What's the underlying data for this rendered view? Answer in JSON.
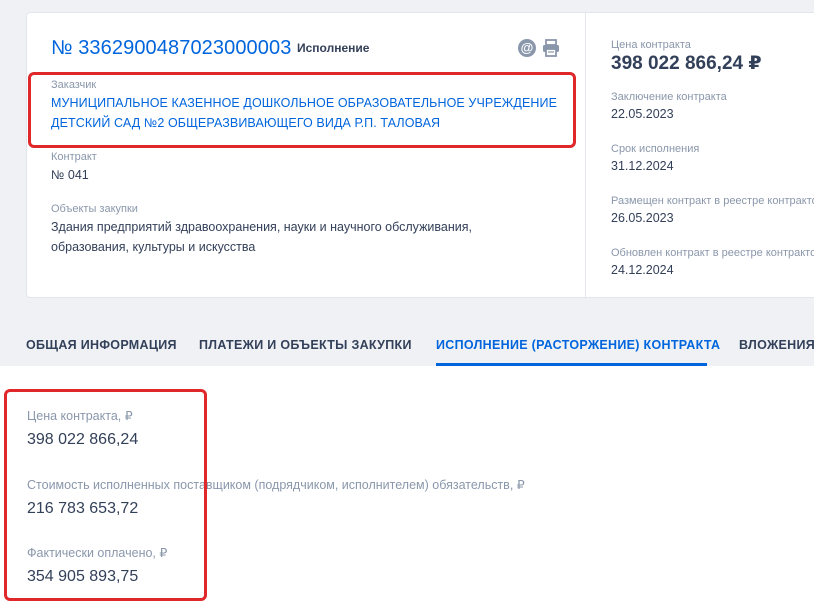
{
  "contract": {
    "number": "№ 3362900487023000003",
    "status": "Исполнение",
    "customer_label": "Заказчик",
    "customer_line1": "МУНИЦИПАЛЬНОЕ КАЗЕННОЕ ДОШКОЛЬНОЕ ОБРАЗОВАТЕЛЬНОЕ УЧРЕЖДЕНИЕ",
    "customer_line2": "ДЕТСКИЙ САД №2 ОБЩЕРАЗВИВАЮЩЕГО ВИДА Р.П. ТАЛОВАЯ",
    "contract_label": "Контракт",
    "contract_value": "№ 041",
    "objects_label": "Объекты закупки",
    "objects_line1": "Здания предприятий здравоохранения, науки и научного обслуживания,",
    "objects_line2": "образования, культуры и искусства"
  },
  "icons": {
    "email_glyph": "@"
  },
  "summary": {
    "price_label": "Цена контракта",
    "price_value": "398 022 866,24 ₽",
    "conclusion_label": "Заключение контракта",
    "conclusion_value": "22.05.2023",
    "term_label": "Срок исполнения",
    "term_value": "31.12.2024",
    "placed_label": "Размещен контракт в реестре контрактов",
    "placed_value": "26.05.2023",
    "updated_label": "Обновлен контракт в реестре контрактов",
    "updated_value": "24.12.2024"
  },
  "tabs": [
    {
      "label": "ОБЩАЯ ИНФОРМАЦИЯ"
    },
    {
      "label": "ПЛАТЕЖИ И ОБЪЕКТЫ ЗАКУПКИ"
    },
    {
      "label": "ИСПОЛНЕНИЕ (РАСТОРЖЕНИЕ) КОНТРАКТА"
    },
    {
      "label": "ВЛОЖЕНИЯ"
    }
  ],
  "execution": {
    "price_label": "Цена контракта, ₽",
    "price_value": "398 022 866,24",
    "fulfilled_label": "Стоимость исполненных поставщиком (подрядчиком, исполнителем) обязательств, ₽",
    "fulfilled_value": "216 783 653,72",
    "paid_label": "Фактически оплачено, ₽",
    "paid_value": "354 905 893,75"
  },
  "colors": {
    "accent": "#0065dd",
    "highlight": "#e0282a",
    "muted": "#8a97ab",
    "text": "#334059"
  }
}
